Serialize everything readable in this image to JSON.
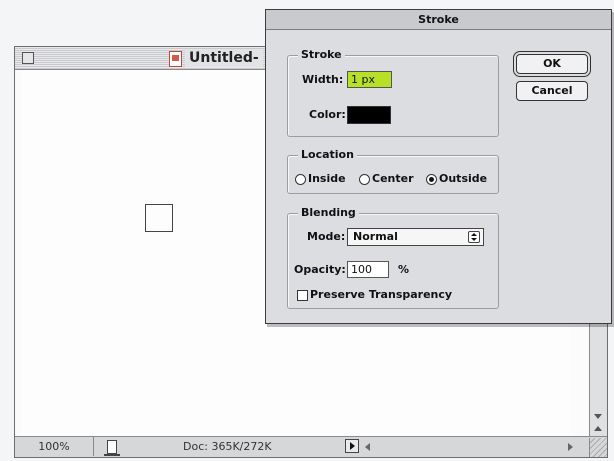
{
  "document": {
    "title": "Untitled-",
    "zoom": "100%",
    "doc_size": "Doc: 365K/272K"
  },
  "dialog": {
    "title": "Stroke",
    "stroke_group": {
      "title": "Stroke",
      "width_label": "Width:",
      "width_value": "1 px",
      "color_label": "Color:",
      "color_value": "#000000"
    },
    "location_group": {
      "title": "Location",
      "options": [
        "Inside",
        "Center",
        "Outside"
      ],
      "selected": "Outside"
    },
    "blending_group": {
      "title": "Blending",
      "mode_label": "Mode:",
      "mode_value": "Normal",
      "opacity_label": "Opacity:",
      "opacity_value": "100",
      "opacity_unit": "%",
      "preserve_transparency_label": "Preserve Transparency",
      "preserve_transparency_checked": false
    },
    "buttons": {
      "ok": "OK",
      "cancel": "Cancel"
    }
  },
  "colors": {
    "width_field_highlight": "#b8e026",
    "stroke_color": "#000000"
  }
}
